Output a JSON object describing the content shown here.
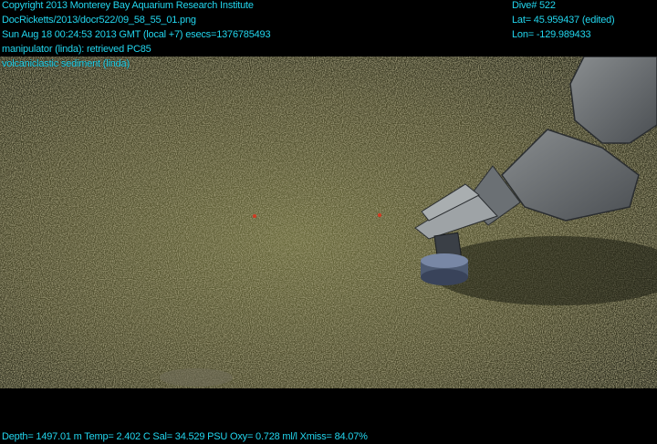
{
  "overlay": {
    "copyright": "Copyright 2013 Monterey Bay Aquarium Research Institute",
    "file_path": "DocRicketts/2013/docr522/09_58_55_01.png",
    "datetime": "Sun Aug 18 00:24:53 2013 GMT (local +7)  esecs=1376785493",
    "annotation_1": "manipulator (linda): retrieved PC85",
    "annotation_2": "volcaniclastic sediment (linda)",
    "dive": "Dive# 522",
    "latitude": "Lat= 45.959437 (edited)",
    "longitude": "Lon= -129.989433",
    "sensors": "Depth= 1497.01 m  Temp= 2.402 C  Sal= 34.529 PSU  Oxy= 0.728 ml/l  Xmiss= 84.07%"
  },
  "colors": {
    "overlay_text": "#22d6ee",
    "sediment": "#5e5a36",
    "letterbox": "#000000"
  },
  "scene": {
    "subject": "ROV manipulator arm retrieving push core on seafloor sediment"
  }
}
